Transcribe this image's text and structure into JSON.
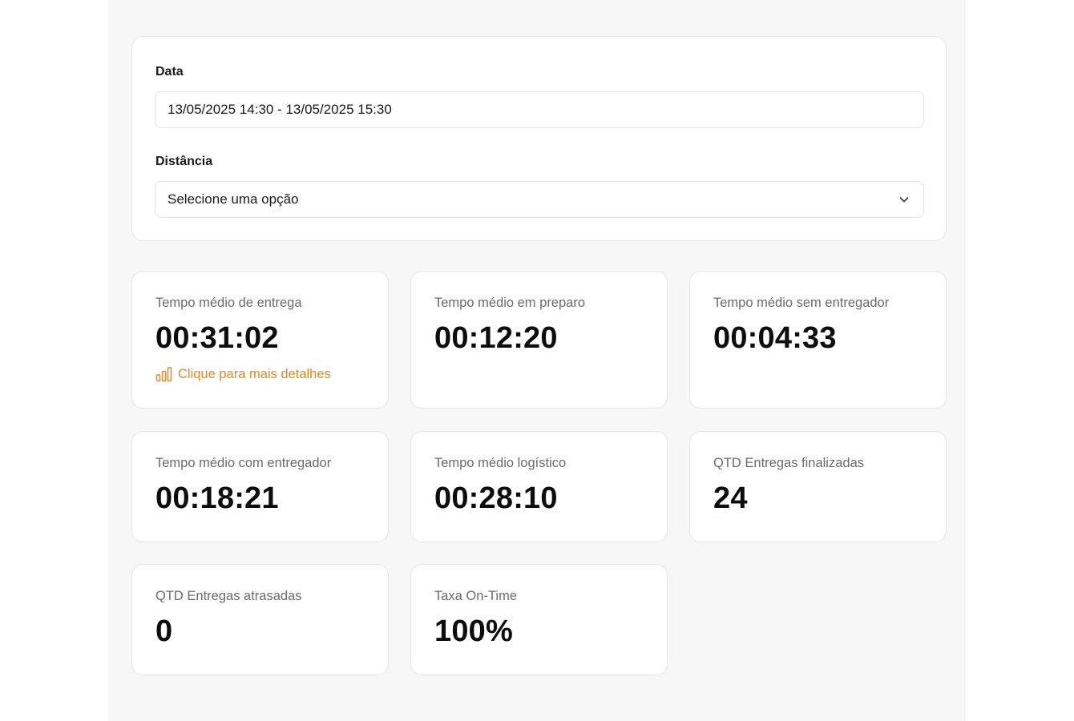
{
  "filters": {
    "date_label": "Data",
    "date_value": "13/05/2025 14:30 - 13/05/2025 15:30",
    "distance_label": "Distância",
    "distance_value": "Selecione uma opção"
  },
  "metrics": [
    {
      "label": "Tempo médio de entrega",
      "value": "00:31:02",
      "link": "Clique para mais detalhes"
    },
    {
      "label": "Tempo médio em preparo",
      "value": "00:12:20"
    },
    {
      "label": "Tempo médio sem entregador",
      "value": "00:04:33"
    },
    {
      "label": "Tempo médio com entregador",
      "value": "00:18:21"
    },
    {
      "label": "Tempo médio logístico",
      "value": "00:28:10"
    },
    {
      "label": "QTD Entregas finalizadas",
      "value": "24"
    },
    {
      "label": "QTD Entregas atrasadas",
      "value": "0"
    },
    {
      "label": "Taxa On-Time",
      "value": "100%"
    }
  ],
  "colors": {
    "accent": "#e08a1e",
    "page_background": "#f7f7f7",
    "card_background": "#ffffff",
    "muted_text": "#6b6b6b"
  },
  "icons": {
    "select_chevron": "chevron-down-icon",
    "details_link": "bar-chart-icon"
  }
}
